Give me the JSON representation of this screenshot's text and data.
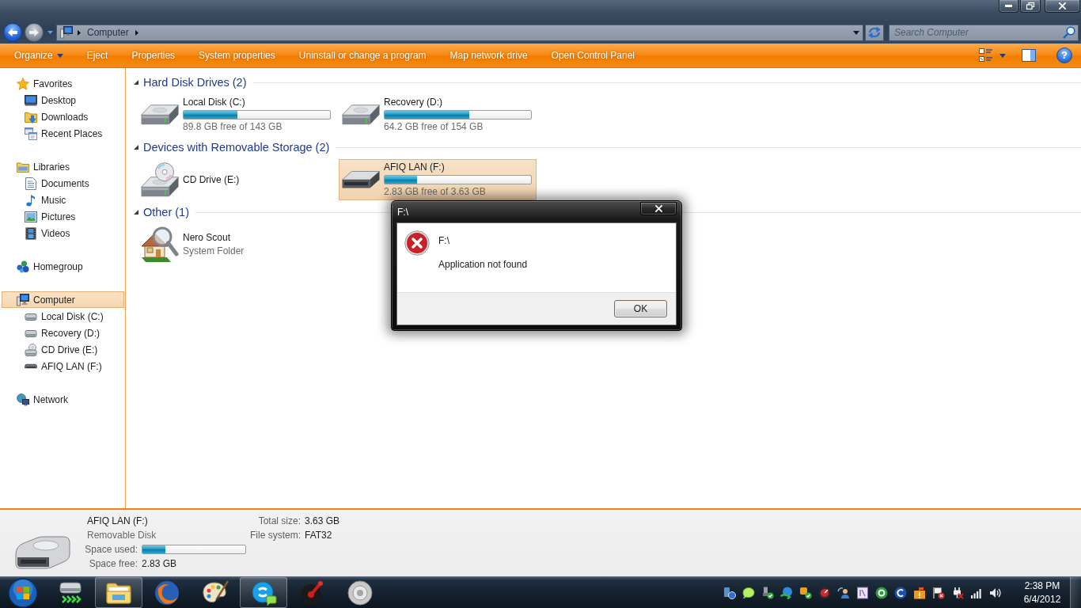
{
  "address_bar": {
    "crumbs": [
      {
        "label": "Computer"
      }
    ]
  },
  "search": {
    "placeholder": "Search Computer"
  },
  "toolbar": {
    "commands": [
      {
        "label": "Organize",
        "kind": "menu"
      },
      {
        "label": "Eject",
        "kind": "command"
      },
      {
        "label": "Properties",
        "kind": "command"
      },
      {
        "label": "System properties",
        "kind": "command"
      },
      {
        "label": "Uninstall or change a program",
        "kind": "command"
      },
      {
        "label": "Map network drive",
        "kind": "command"
      },
      {
        "label": "Open Control Panel",
        "kind": "command"
      }
    ],
    "help": "?"
  },
  "sidebar": {
    "groups": [
      {
        "label": "Favorites",
        "kind": "favorites",
        "selected": false,
        "children": [
          {
            "label": "Desktop",
            "kind": "desktop",
            "selected": false
          },
          {
            "label": "Downloads",
            "kind": "downloads",
            "selected": false
          },
          {
            "label": "Recent Places",
            "kind": "recent",
            "selected": false
          }
        ]
      },
      {
        "label": "Libraries",
        "kind": "library",
        "selected": false,
        "children": [
          {
            "label": "Documents",
            "kind": "document",
            "selected": false
          },
          {
            "label": "Music",
            "kind": "music",
            "selected": false
          },
          {
            "label": "Pictures",
            "kind": "picture",
            "selected": false
          },
          {
            "label": "Videos",
            "kind": "video",
            "selected": false
          }
        ]
      },
      {
        "label": "Homegroup",
        "kind": "homegroup",
        "selected": false
      },
      {
        "label": "Computer",
        "kind": "computer",
        "selected": true,
        "children": [
          {
            "label": "Local Disk (C:)",
            "kind": "hdd",
            "selected": false
          },
          {
            "label": "Recovery (D:)",
            "kind": "hdd",
            "selected": false
          },
          {
            "label": "CD Drive (E:)",
            "kind": "cd",
            "selected": false
          },
          {
            "label": "AFIQ LAN (F:)",
            "kind": "removable",
            "selected": false
          }
        ]
      },
      {
        "label": "Network",
        "kind": "network",
        "selected": false
      }
    ]
  },
  "sections": [
    {
      "title": "Hard Disk Drives (2)",
      "expanded": true,
      "items": [
        {
          "kind": "hdd",
          "name": "Local Disk (C:)",
          "level": 0.37,
          "detail": "89.8 GB free of 143 GB",
          "selected": false
        },
        {
          "kind": "hdd",
          "name": "Recovery (D:)",
          "level": 0.58,
          "detail": "64.2 GB free of 154 GB",
          "selected": false
        }
      ]
    },
    {
      "title": "Devices with Removable Storage (2)",
      "expanded": true,
      "items": [
        {
          "kind": "cd",
          "name": "CD Drive (E:)",
          "selected": false
        },
        {
          "kind": "removable",
          "name": "AFIQ LAN (F:)",
          "level": 0.22,
          "detail": "2.83 GB free of 3.63 GB",
          "selected": true
        }
      ]
    },
    {
      "title": "Other (1)",
      "expanded": true,
      "items": [
        {
          "kind": "scout",
          "name": "Nero Scout",
          "detail": "System Folder",
          "selected": false
        }
      ]
    }
  ],
  "details": {
    "name": "AFIQ LAN (F:)",
    "type": "Removable Disk",
    "properties": [
      {
        "label": "Space used:",
        "kind": "bar",
        "level": 0.22
      },
      {
        "label": "Space free:",
        "kind": "text",
        "value": "2.83 GB"
      }
    ],
    "summary": [
      {
        "label": "Total size:",
        "value": "3.63 GB"
      },
      {
        "label": "File system:",
        "value": "FAT32"
      }
    ]
  },
  "dialog": {
    "title": "F:\\",
    "heading": "F:\\",
    "message": "Application not found",
    "buttons": [
      {
        "label": "OK"
      }
    ]
  },
  "taskbar": {
    "apps": [
      {
        "kind": "drive",
        "running": false
      },
      {
        "kind": "folder",
        "running": true
      },
      {
        "kind": "globe",
        "running": false
      },
      {
        "kind": "palette",
        "running": false
      },
      {
        "kind": "chat",
        "running": true
      },
      {
        "kind": "turntable",
        "running": false
      },
      {
        "kind": "medal",
        "running": false
      }
    ],
    "clock": {
      "time": "2:38 PM",
      "date": "6/4/2012"
    }
  }
}
